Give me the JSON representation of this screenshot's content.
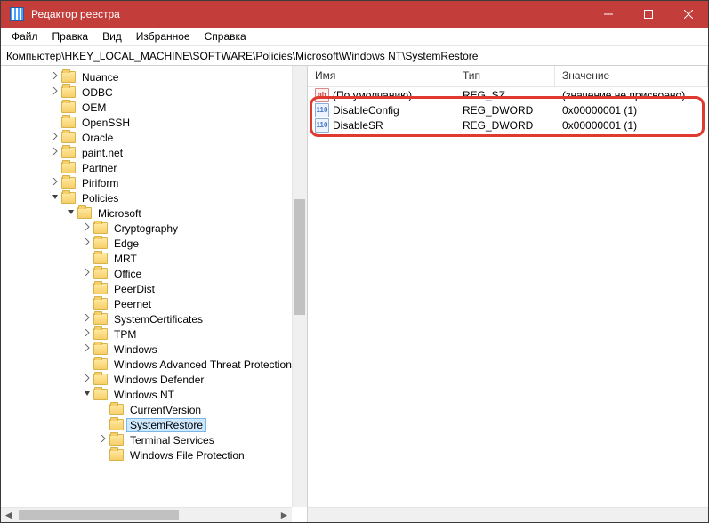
{
  "window": {
    "title": "Редактор реестра"
  },
  "menu": {
    "file": "Файл",
    "edit": "Правка",
    "view": "Вид",
    "favorites": "Избранное",
    "help": "Справка"
  },
  "address": "Компьютер\\HKEY_LOCAL_MACHINE\\SOFTWARE\\Policies\\Microsoft\\Windows NT\\SystemRestore",
  "tree": [
    {
      "indent": 3,
      "chev": ">",
      "label": "Nuance"
    },
    {
      "indent": 3,
      "chev": ">",
      "label": "ODBC"
    },
    {
      "indent": 3,
      "chev": "",
      "label": "OEM"
    },
    {
      "indent": 3,
      "chev": "",
      "label": "OpenSSH"
    },
    {
      "indent": 3,
      "chev": ">",
      "label": "Oracle"
    },
    {
      "indent": 3,
      "chev": ">",
      "label": "paint.net"
    },
    {
      "indent": 3,
      "chev": "",
      "label": "Partner"
    },
    {
      "indent": 3,
      "chev": ">",
      "label": "Piriform"
    },
    {
      "indent": 3,
      "chev": "v",
      "label": "Policies"
    },
    {
      "indent": 4,
      "chev": "v",
      "label": "Microsoft"
    },
    {
      "indent": 5,
      "chev": ">",
      "label": "Cryptography"
    },
    {
      "indent": 5,
      "chev": ">",
      "label": "Edge"
    },
    {
      "indent": 5,
      "chev": "",
      "label": "MRT"
    },
    {
      "indent": 5,
      "chev": ">",
      "label": "Office"
    },
    {
      "indent": 5,
      "chev": "",
      "label": "PeerDist"
    },
    {
      "indent": 5,
      "chev": "",
      "label": "Peernet"
    },
    {
      "indent": 5,
      "chev": ">",
      "label": "SystemCertificates"
    },
    {
      "indent": 5,
      "chev": ">",
      "label": "TPM"
    },
    {
      "indent": 5,
      "chev": ">",
      "label": "Windows"
    },
    {
      "indent": 5,
      "chev": "",
      "label": "Windows Advanced Threat Protection"
    },
    {
      "indent": 5,
      "chev": ">",
      "label": "Windows Defender"
    },
    {
      "indent": 5,
      "chev": "v",
      "label": "Windows NT"
    },
    {
      "indent": 6,
      "chev": "",
      "label": "CurrentVersion"
    },
    {
      "indent": 6,
      "chev": "",
      "label": "SystemRestore",
      "selected": true
    },
    {
      "indent": 6,
      "chev": ">",
      "label": "Terminal Services"
    },
    {
      "indent": 6,
      "chev": "",
      "label": "Windows File Protection"
    }
  ],
  "columns": {
    "name": "Имя",
    "type": "Тип",
    "value": "Значение"
  },
  "rows": [
    {
      "icon": "string",
      "iconText": "ab",
      "name": "(По умолчанию)",
      "type": "REG_SZ",
      "value": "(значение не присвоено)"
    },
    {
      "icon": "dword",
      "iconText": "110",
      "name": "DisableConfig",
      "type": "REG_DWORD",
      "value": "0x00000001 (1)"
    },
    {
      "icon": "dword",
      "iconText": "110",
      "name": "DisableSR",
      "type": "REG_DWORD",
      "value": "0x00000001 (1)"
    }
  ]
}
